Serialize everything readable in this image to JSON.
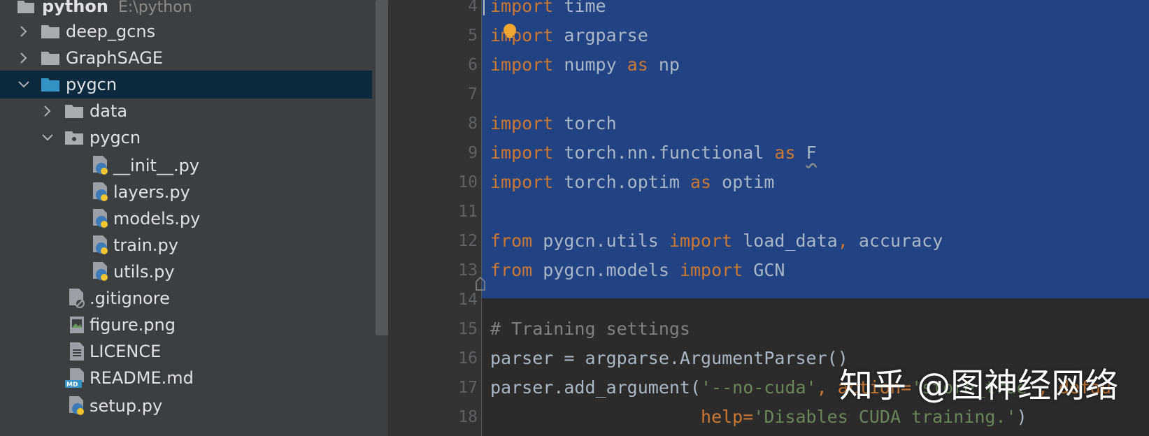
{
  "project": {
    "root_name": "python",
    "root_path": "E:\\python",
    "items": [
      {
        "label": "deep_gcns"
      },
      {
        "label": "GraphSAGE"
      },
      {
        "label": "pygcn"
      },
      {
        "label": "data"
      },
      {
        "label": "pygcn"
      },
      {
        "label": "__init__.py"
      },
      {
        "label": "layers.py"
      },
      {
        "label": "models.py"
      },
      {
        "label": "train.py"
      },
      {
        "label": "utils.py"
      },
      {
        "label": ".gitignore"
      },
      {
        "label": "figure.png"
      },
      {
        "label": "LICENCE"
      },
      {
        "label": "README.md"
      },
      {
        "label": "setup.py"
      }
    ]
  },
  "editor": {
    "line_numbers": [
      "4",
      "5",
      "6",
      "7",
      "8",
      "9",
      "10",
      "11",
      "12",
      "13",
      "14",
      "15",
      "16",
      "17",
      "18"
    ],
    "lines": [
      [
        {
          "t": "import",
          "c": "kw"
        },
        {
          "t": " time",
          "c": "nm"
        }
      ],
      [
        {
          "t": "import",
          "c": "kw"
        },
        {
          "t": " argparse",
          "c": "nm"
        }
      ],
      [
        {
          "t": "import",
          "c": "kw"
        },
        {
          "t": " numpy ",
          "c": "nm"
        },
        {
          "t": "as",
          "c": "kw"
        },
        {
          "t": " np",
          "c": "nm"
        }
      ],
      [],
      [
        {
          "t": "import",
          "c": "kw"
        },
        {
          "t": " torch",
          "c": "nm"
        }
      ],
      [
        {
          "t": "import",
          "c": "kw"
        },
        {
          "t": " torch.nn.functional ",
          "c": "nm"
        },
        {
          "t": "as",
          "c": "kw"
        },
        {
          "t": " ",
          "c": "nm"
        },
        {
          "t": "F",
          "c": "nm squiggle"
        }
      ],
      [
        {
          "t": "import",
          "c": "kw"
        },
        {
          "t": " torch.optim ",
          "c": "nm"
        },
        {
          "t": "as",
          "c": "kw"
        },
        {
          "t": " optim",
          "c": "nm"
        }
      ],
      [],
      [
        {
          "t": "from",
          "c": "kw"
        },
        {
          "t": " pygcn.utils ",
          "c": "nm"
        },
        {
          "t": "import",
          "c": "kw"
        },
        {
          "t": " load_data",
          "c": "nm"
        },
        {
          "t": ",",
          "c": "kw"
        },
        {
          "t": " accuracy",
          "c": "nm"
        }
      ],
      [
        {
          "t": "from",
          "c": "kw"
        },
        {
          "t": " pygcn.models ",
          "c": "nm"
        },
        {
          "t": "import",
          "c": "kw"
        },
        {
          "t": " GCN",
          "c": "nm"
        }
      ],
      [],
      [
        {
          "t": "# Training settings",
          "c": "cm"
        }
      ],
      [
        {
          "t": "parser = argparse.ArgumentParser()",
          "c": "nm"
        }
      ],
      [
        {
          "t": "parser.add_argument(",
          "c": "nm"
        },
        {
          "t": "'--no-cuda'",
          "c": "st"
        },
        {
          "t": ", ",
          "c": "kw"
        },
        {
          "t": "action=",
          "c": "kw"
        },
        {
          "t": "'store_true'",
          "c": "st"
        },
        {
          "t": ", ",
          "c": "kw"
        },
        {
          "t": "defau",
          "c": "kw"
        }
      ],
      [
        {
          "t": "                    ",
          "c": "nm"
        },
        {
          "t": "help=",
          "c": "kw"
        },
        {
          "t": "'Disables CUDA training.'",
          "c": "st"
        },
        {
          "t": ")",
          "c": "nm"
        }
      ]
    ]
  },
  "watermark": "知乎 @图神经网络",
  "colors": {
    "selection": "#214283",
    "keyword": "#cc7832",
    "comment": "#808080",
    "string": "#6a8759",
    "text": "#a9b7c6",
    "tree_selected": "#0d293e",
    "folder": "#a8adb2",
    "folder_selected": "#3592c4"
  }
}
